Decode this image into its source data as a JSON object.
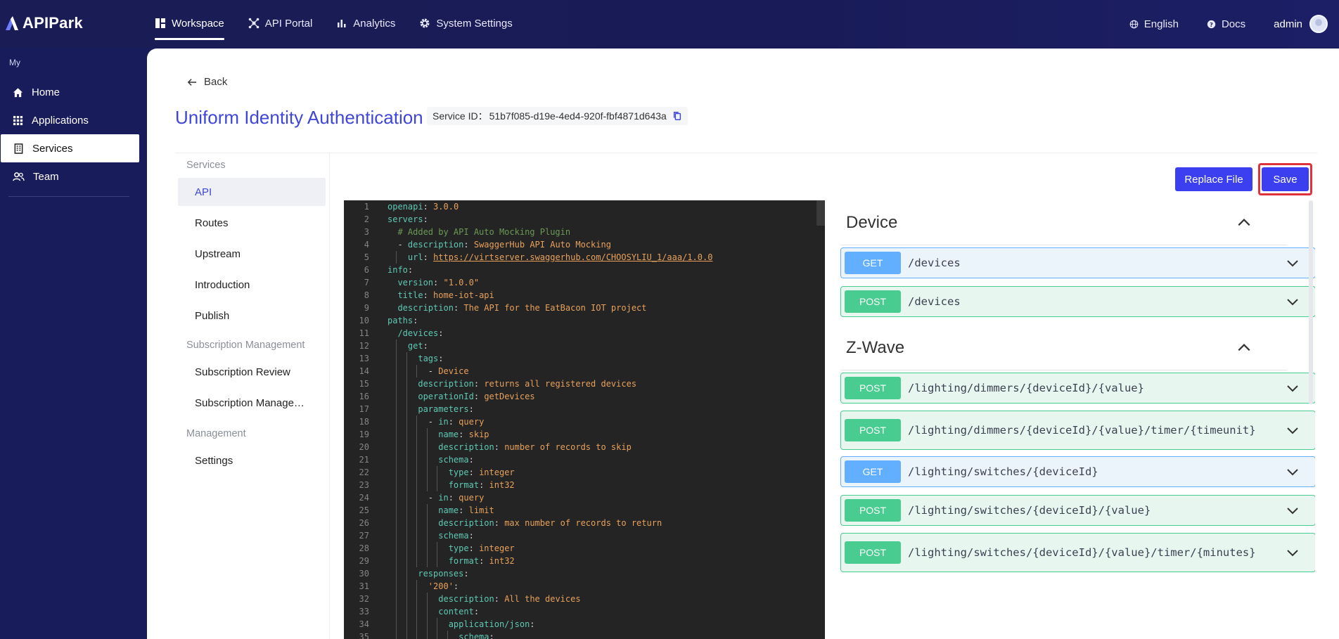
{
  "app": {
    "name": "APIPark"
  },
  "nav": {
    "items": [
      {
        "label": "Workspace",
        "icon": "dashboard-icon",
        "active": true
      },
      {
        "label": "API Portal",
        "icon": "portal-icon",
        "active": false
      },
      {
        "label": "Analytics",
        "icon": "bar-chart-icon",
        "active": false
      },
      {
        "label": "System Settings",
        "icon": "gear-icon",
        "active": false
      }
    ],
    "language": "English",
    "docs": "Docs",
    "user": "admin"
  },
  "sidebar": {
    "section": "My",
    "items": [
      {
        "label": "Home",
        "icon": "home-icon"
      },
      {
        "label": "Applications",
        "icon": "grid-icon"
      },
      {
        "label": "Services",
        "icon": "building-icon",
        "active": true
      },
      {
        "label": "Team",
        "icon": "team-icon"
      }
    ]
  },
  "page": {
    "back": "Back",
    "title": "Uniform Identity Authentication",
    "service_id_label": "Service ID：",
    "service_id": "51b7f085-d19e-4ed4-920f-fbf4871d643a"
  },
  "submenu": {
    "group1": "Services",
    "items1": [
      "API",
      "Routes",
      "Upstream",
      "Introduction",
      "Publish"
    ],
    "group2": "Subscription Management",
    "items2": [
      "Subscription Review",
      "Subscription Management"
    ],
    "group3": "Management",
    "items3": [
      "Settings"
    ]
  },
  "buttons": {
    "replace": "Replace File",
    "save": "Save"
  },
  "editor": {
    "lines": [
      "openapi: 3.0.0",
      "servers:",
      "  # Added by API Auto Mocking Plugin",
      "  - description: SwaggerHub API Auto Mocking",
      "    url: https://virtserver.swaggerhub.com/CHOOSYLIU_1/aaa/1.0.0",
      "info:",
      "  version: \"1.0.0\"",
      "  title: home-iot-api",
      "  description: The API for the EatBacon IOT project",
      "paths:",
      "  /devices:",
      "    get:",
      "      tags:",
      "        - Device",
      "      description: returns all registered devices",
      "      operationId: getDevices",
      "      parameters:",
      "        - in: query",
      "          name: skip",
      "          description: number of records to skip",
      "          schema:",
      "            type: integer",
      "            format: int32",
      "        - in: query",
      "          name: limit",
      "          description: max number of records to return",
      "          schema:",
      "            type: integer",
      "            format: int32",
      "      responses:",
      "        '200':",
      "          description: All the devices",
      "          content:",
      "            application/json:",
      "              schema:"
    ]
  },
  "api_panel": {
    "groups": [
      {
        "name": "Device",
        "operations": [
          {
            "method": "GET",
            "path": "/devices"
          },
          {
            "method": "POST",
            "path": "/devices"
          }
        ]
      },
      {
        "name": "Z-Wave",
        "operations": [
          {
            "method": "POST",
            "path": "/lighting/dimmers/{deviceId}/{value}"
          },
          {
            "method": "POST",
            "path": "/lighting/dimmers/{deviceId}/{value}/timer/{timeunit}"
          },
          {
            "method": "GET",
            "path": "/lighting/switches/{deviceId}"
          },
          {
            "method": "POST",
            "path": "/lighting/switches/{deviceId}/{value}"
          },
          {
            "method": "POST",
            "path": "/lighting/switches/{deviceId}/{value}/timer/{minutes}"
          }
        ]
      }
    ]
  },
  "colors": {
    "brand": "#3f46d8",
    "button": "#3b3fef",
    "get": "#61affe",
    "post": "#49cc90",
    "highlight": "#e0323a"
  }
}
